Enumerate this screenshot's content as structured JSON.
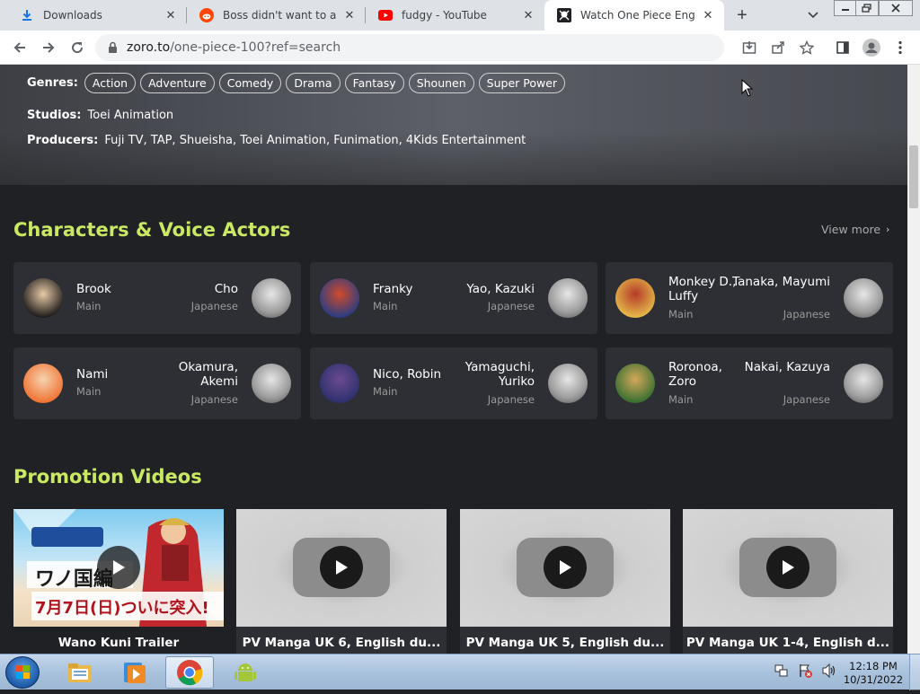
{
  "browser": {
    "tabs": [
      {
        "title": "Downloads",
        "icon": "download-icon",
        "active": false
      },
      {
        "title": "Boss didn't want to appro",
        "icon": "reddit-icon",
        "active": false
      },
      {
        "title": "fudgy - YouTube",
        "icon": "youtube-icon",
        "active": false
      },
      {
        "title": "Watch One Piece English",
        "icon": "zoro-icon",
        "active": true
      }
    ],
    "new_tab": "+",
    "url_host": "zoro.to",
    "url_path": "/one-piece-100?ref=search"
  },
  "anime": {
    "genres_label": "Genres:",
    "genres": [
      "Action",
      "Adventure",
      "Comedy",
      "Drama",
      "Fantasy",
      "Shounen",
      "Super Power"
    ],
    "studios_label": "Studios:",
    "studios": "Toei Animation",
    "producers_label": "Producers:",
    "producers": "Fuji TV, TAP, Shueisha, Toei Animation, Funimation, 4Kids Entertainment"
  },
  "characters": {
    "title": "Characters & Voice Actors",
    "view_more": "View more",
    "items": [
      {
        "name": "Brook",
        "role": "Main",
        "actor": "Cho",
        "lang": "Japanese",
        "name_lines": 1,
        "actor_lines": 1
      },
      {
        "name": "Franky",
        "role": "Main",
        "actor": "Yao, Kazuki",
        "lang": "Japanese",
        "name_lines": 1,
        "actor_lines": 1
      },
      {
        "name": "Monkey D., Luffy",
        "role": "Main",
        "actor": "Tanaka, Mayumi",
        "lang": "Japanese",
        "name_lines": 2,
        "actor_lines": 2
      },
      {
        "name": "Nami",
        "role": "Main",
        "actor": "Okamura, Akemi",
        "lang": "Japanese",
        "name_lines": 1,
        "actor_lines": 2
      },
      {
        "name": "Nico, Robin",
        "role": "Main",
        "actor": "Yamaguchi, Yuriko",
        "lang": "Japanese",
        "name_lines": 1,
        "actor_lines": 2
      },
      {
        "name": "Roronoa, Zoro",
        "role": "Main",
        "actor": "Nakai, Kazuya",
        "lang": "Japanese",
        "name_lines": 2,
        "actor_lines": 2
      }
    ]
  },
  "promotion": {
    "title": "Promotion Videos",
    "videos": [
      {
        "title": "Wano Kuni Trailer",
        "thumb_text": "ワノ国編",
        "thumb_date": "7月7日(日)ついに突入!"
      },
      {
        "title": "PV Manga UK 6, English du..."
      },
      {
        "title": "PV Manga UK 5, English du..."
      },
      {
        "title": "PV Manga UK 1-4, English d..."
      }
    ]
  },
  "taskbar": {
    "time": "12:18 PM",
    "date": "10/31/2022",
    "apps": [
      "explorer-icon",
      "media-player-icon",
      "chrome-icon",
      "android-icon"
    ]
  },
  "colors": {
    "accent": "#cae962",
    "page_bg": "#202125",
    "card_bg": "#2e2f34"
  }
}
